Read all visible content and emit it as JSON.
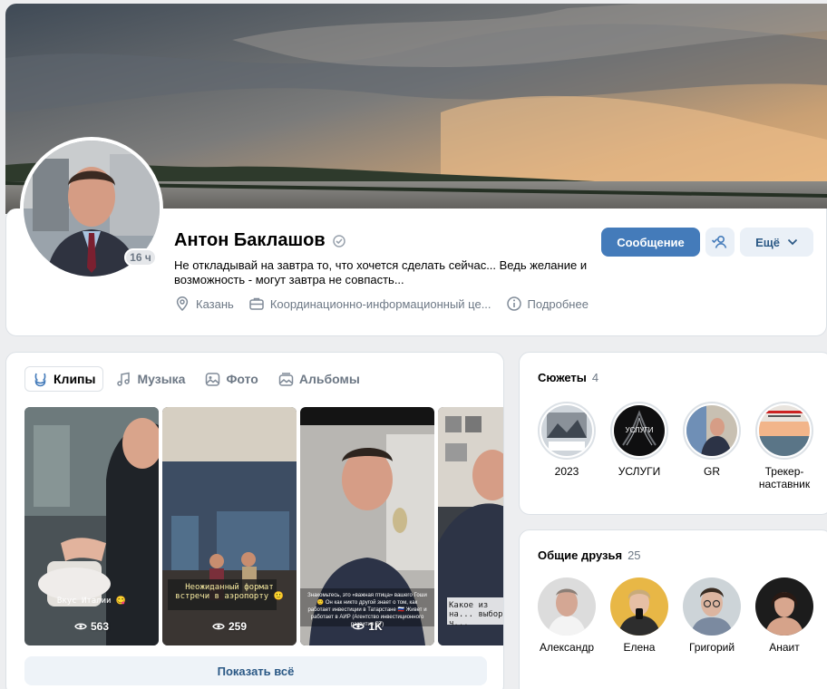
{
  "profile": {
    "name": "Антон Баклашов",
    "story_badge": "16 ч",
    "status": "Не откладывай на завтра то, что хочется сделать сейчас... Ведь желание и возможность - могут завтра не совпасть...",
    "city": "Казань",
    "work": "Координационно-информационный це...",
    "more_info": "Подробнее"
  },
  "actions": {
    "message": "Сообщение",
    "more": "Ещё"
  },
  "tabs": [
    {
      "label": "Клипы",
      "icon": "clips-icon",
      "active": true
    },
    {
      "label": "Музыка",
      "icon": "music-icon",
      "active": false
    },
    {
      "label": "Фото",
      "icon": "photo-icon",
      "active": false
    },
    {
      "label": "Альбомы",
      "icon": "albums-icon",
      "active": false
    }
  ],
  "clips": [
    {
      "views": "563",
      "caption": "Вкус Италии 😋"
    },
    {
      "views": "259",
      "caption": "Неожиданный формат встречи в аэропорту 🙂"
    },
    {
      "views": "1K",
      "caption": "Знакомьтесь, это «важная птица» вашего Гоши 🙂 Он как никто другой знает о том, как работает инвестиции в Татарстане 🇷🇺 Живет и работает в АИР (Агентство инвестиционного развития РТ)"
    },
    {
      "views": "",
      "caption": "Какое из на... выбор ч..."
    }
  ],
  "show_all": "Показать всё",
  "stories_section": {
    "title": "Сюжеты",
    "count": "4",
    "items": [
      {
        "label": "2023"
      },
      {
        "label": "УСЛУГИ"
      },
      {
        "label": "GR"
      },
      {
        "label": "Трекер-наставник"
      }
    ]
  },
  "friends_section": {
    "title": "Общие друзья",
    "count": "25",
    "items": [
      {
        "label": "Александр"
      },
      {
        "label": "Елена"
      },
      {
        "label": "Григорий"
      },
      {
        "label": "Анаит"
      }
    ]
  },
  "colors": {
    "accent": "#447bba",
    "secondary_button_bg": "#eaf0f7",
    "link": "#2a5885",
    "muted": "#6d7885"
  }
}
